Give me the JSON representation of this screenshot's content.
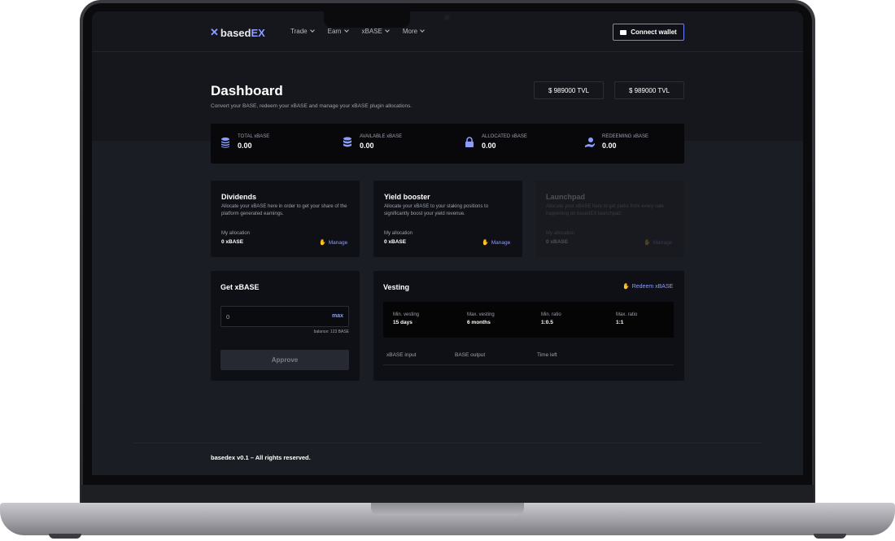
{
  "nav": {
    "logo_prefix": "based",
    "logo_accent": "EX",
    "logo_mark_icon": "x-logo-icon",
    "menu": [
      {
        "label": "Trade"
      },
      {
        "label": "Earn"
      },
      {
        "label": "xBASE"
      },
      {
        "label": "More"
      }
    ],
    "connect_label": "Connect wallet"
  },
  "header": {
    "title": "Dashboard",
    "subtitle": "Convert your BASE, redeem your xBASE and manage your xBASE plugin allocations.",
    "tvl_a": "$ 989000 TVL",
    "tvl_b": "$ 989000 TVL"
  },
  "stats": [
    {
      "label": "TOTAL xBASE",
      "value": "0.00",
      "icon": "coins-stack-icon"
    },
    {
      "label": "AVAILABLE xBASE",
      "value": "0.00",
      "icon": "database-icon"
    },
    {
      "label": "ALLOCATED xBASE",
      "value": "0.00",
      "icon": "lock-icon"
    },
    {
      "label": "REDEEMING xBASE",
      "value": "0.00",
      "icon": "hand-coin-icon"
    }
  ],
  "plugins": [
    {
      "title": "Dividends",
      "desc": "Allocate your xBASE here in order to get your share of the platform generated earnings.",
      "alloc_label": "My allocation",
      "alloc_value": "0 xBASE",
      "manage_label": "Manage"
    },
    {
      "title": "Yield booster",
      "desc": "Allocate your xBASE to your staking positions to significantly boost your yield revenue.",
      "alloc_label": "My allocation",
      "alloc_value": "0 xBASE",
      "manage_label": "Manage"
    },
    {
      "title": "Launchpad",
      "desc": "Allocate your xBASE here to get perks from every sale happening on basedEX launchpad.",
      "alloc_label": "My allocation",
      "alloc_value": "0 xBASE",
      "manage_label": "Manage"
    }
  ],
  "get_xbase": {
    "title": "Get xBASE",
    "input_value": "0",
    "max_label": "max",
    "balance": "balance: 123 BASE",
    "approve_label": "Approve"
  },
  "vesting": {
    "title": "Vesting",
    "redeem_label": "Redeem xBASE",
    "items": [
      {
        "label": "Min. vesting",
        "value": "15 days"
      },
      {
        "label": "Max. vesting",
        "value": "6 months"
      },
      {
        "label": "Min. ratio",
        "value": "1:0.5"
      },
      {
        "label": "Max. ratio",
        "value": "1:1"
      }
    ],
    "columns": [
      "xBASE input",
      "BASE output",
      "Time left"
    ]
  },
  "footer": {
    "text": "basedex v0.1 – All rights reserved."
  },
  "colors": {
    "accent": "#8c9dff",
    "background": "#1b1d24",
    "card": "#0f1015"
  }
}
